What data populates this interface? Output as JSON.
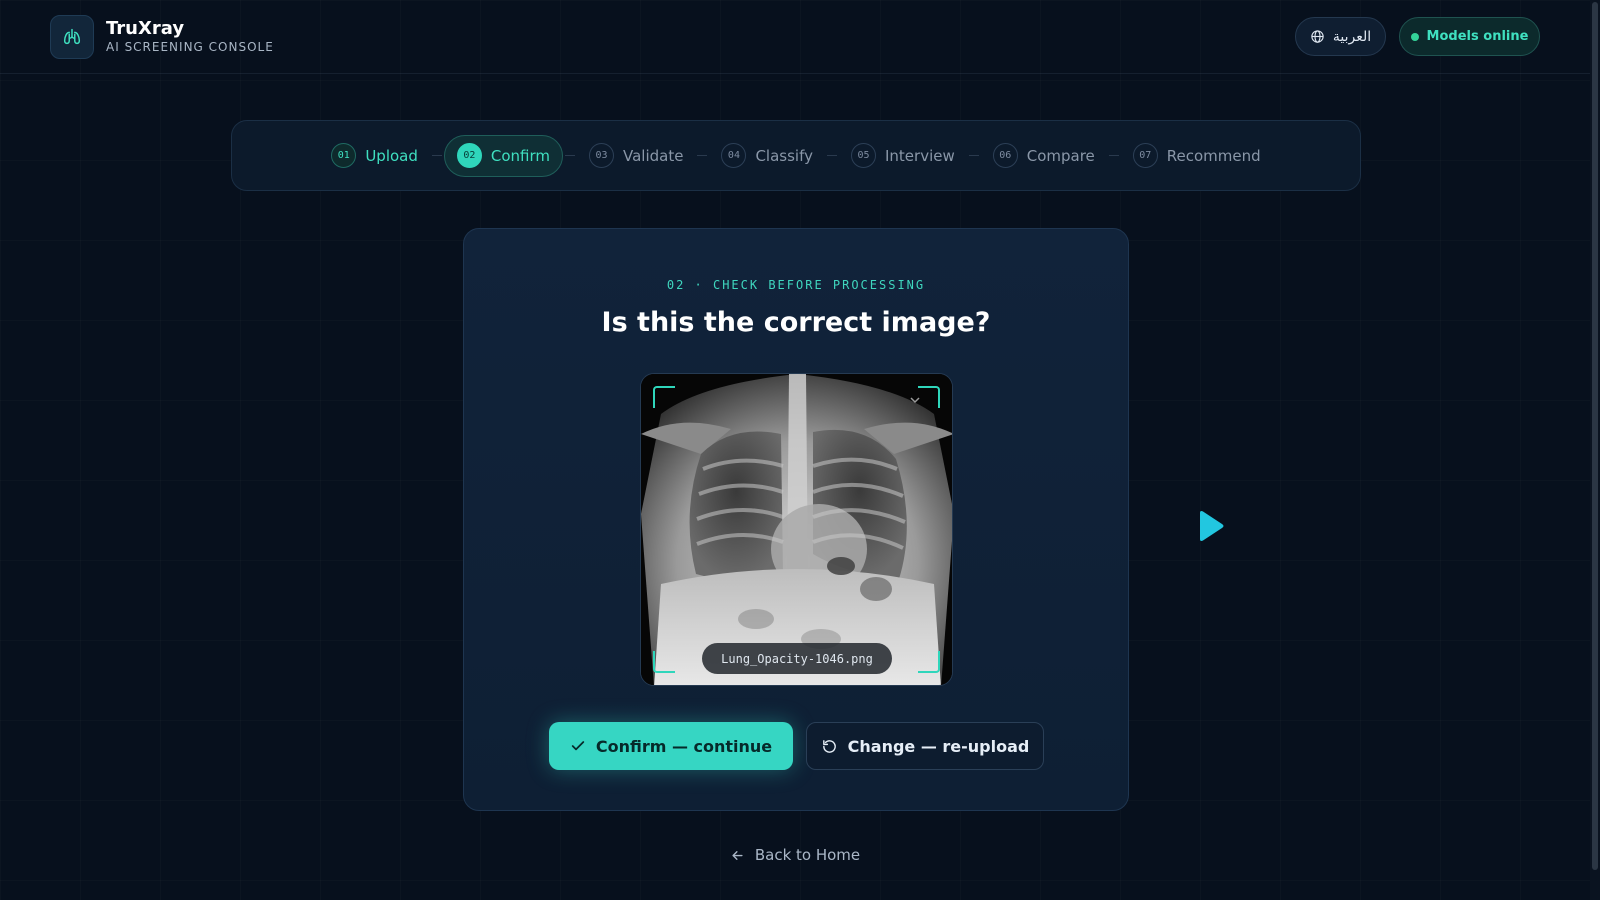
{
  "header": {
    "brand_title": "TruXray",
    "brand_subtitle": "AI SCREENING CONSOLE",
    "language_label": "العربية",
    "status_label": "Models online"
  },
  "stepper": {
    "steps": [
      {
        "num": "01",
        "label": "Upload",
        "state": "done"
      },
      {
        "num": "02",
        "label": "Confirm",
        "state": "active"
      },
      {
        "num": "03",
        "label": "Validate",
        "state": "pending"
      },
      {
        "num": "04",
        "label": "Classify",
        "state": "pending"
      },
      {
        "num": "05",
        "label": "Interview",
        "state": "pending"
      },
      {
        "num": "06",
        "label": "Compare",
        "state": "pending"
      },
      {
        "num": "07",
        "label": "Recommend",
        "state": "pending"
      }
    ]
  },
  "card": {
    "eyebrow": "02 · CHECK BEFORE PROCESSING",
    "question": "Is this the correct image?",
    "filename": "Lung_Opacity-1046.png",
    "confirm_label": "Confirm — continue",
    "change_label": "Change — re-upload"
  },
  "footer": {
    "back_label": "Back to Home"
  },
  "icons": {
    "logo": "lungs-icon",
    "language": "globe-icon",
    "confirm": "check-icon",
    "change": "refresh-icon",
    "back": "arrow-left-icon",
    "play": "play-icon"
  },
  "colors": {
    "accent": "#36d6c3",
    "background": "#07101d",
    "card": "#11233a",
    "status_dot": "#34d399"
  }
}
